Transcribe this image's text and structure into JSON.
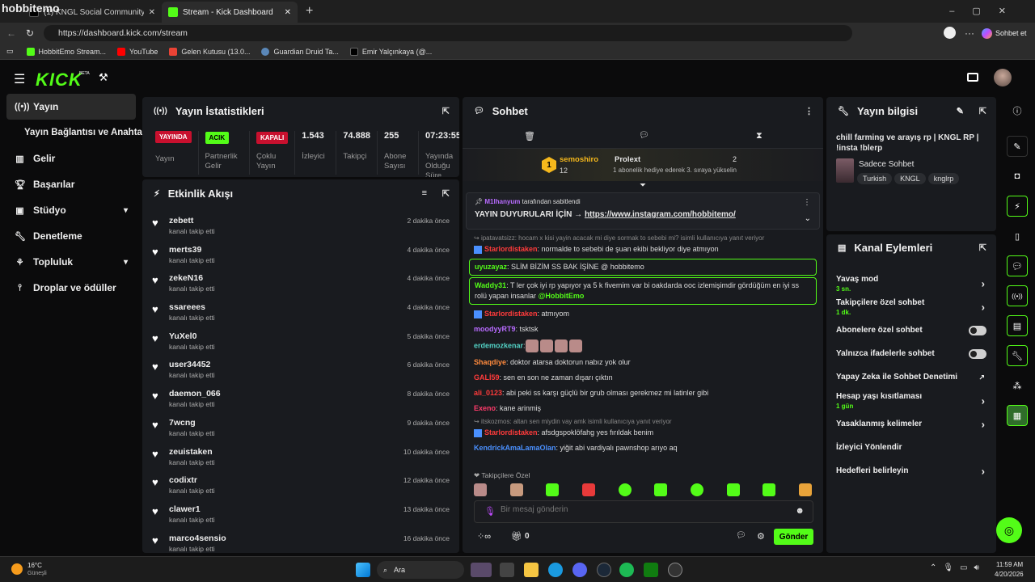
{
  "browser": {
    "watermark": "hobbitemo",
    "tabs": [
      {
        "label": "(1) KNGL Social Community / X"
      },
      {
        "label": "Stream - Kick Dashboard"
      }
    ],
    "url": "https://dashboard.kick.com/stream",
    "profile_btn": "Sohbet et",
    "bookmarks": [
      "HobbitEmo Stream...",
      "YouTube",
      "Gelen Kutusu (13.0...",
      "Guardian Druid Ta...",
      "Emir Yalçınkaya (@..."
    ]
  },
  "header": {
    "logo": "KICK",
    "beta": "BETA"
  },
  "sidebar": {
    "items": [
      {
        "label": "Yayın"
      },
      {
        "label": "Yayın Bağlantısı ve Anahtarı"
      },
      {
        "label": "Gelir"
      },
      {
        "label": "Başarılar"
      },
      {
        "label": "Stüdyo"
      },
      {
        "label": "Denetleme"
      },
      {
        "label": "Topluluk"
      },
      {
        "label": "Droplar ve ödüller"
      }
    ]
  },
  "stats": {
    "title": "Yayın İstatistikleri",
    "items": [
      {
        "badge": "YAYINDA",
        "label": "Yayın"
      },
      {
        "badge": "ACIK",
        "label": "Partnerlik Gelir"
      },
      {
        "badge": "KAPALI",
        "label": "Çoklu Yayın"
      },
      {
        "num": "1.543",
        "label": "İzleyici"
      },
      {
        "num": "74.888",
        "label": "Takipçi"
      },
      {
        "num": "255",
        "label": "Abone Sayısı"
      },
      {
        "num": "07:23:55",
        "label": "Yayında Olduğu Süre"
      }
    ]
  },
  "activity": {
    "title": "Etkinlik Akışı",
    "items": [
      {
        "name": "zebett",
        "sub": "kanalı takip etti",
        "time": "2 dakika önce"
      },
      {
        "name": "merts39",
        "sub": "kanalı takip etti",
        "time": "4 dakika önce"
      },
      {
        "name": "zekeN16",
        "sub": "kanalı takip etti",
        "time": "4 dakika önce"
      },
      {
        "name": "ssareees",
        "sub": "kanalı takip etti",
        "time": "4 dakika önce"
      },
      {
        "name": "YuXel0",
        "sub": "kanalı takip etti",
        "time": "5 dakika önce"
      },
      {
        "name": "user34452",
        "sub": "kanalı takip etti",
        "time": "6 dakika önce"
      },
      {
        "name": "daemon_066",
        "sub": "kanalı takip etti",
        "time": "8 dakika önce"
      },
      {
        "name": "7wcng",
        "sub": "kanalı takip etti",
        "time": "9 dakika önce"
      },
      {
        "name": "zeuistaken",
        "sub": "kanalı takip etti",
        "time": "10 dakika önce"
      },
      {
        "name": "codixtr",
        "sub": "kanalı takip etti",
        "time": "12 dakika önce"
      },
      {
        "name": "clawer1",
        "sub": "kanalı takip etti",
        "time": "13 dakika önce"
      },
      {
        "name": "marco4sensio",
        "sub": "kanalı takip etti",
        "time": "16 dakika önce"
      }
    ]
  },
  "chat": {
    "title": "Sohbet",
    "top_user": "semoshiro",
    "top_count": "12",
    "top_rank": "1",
    "second_user": "Prolext",
    "second_count": "2",
    "gift_note": "1 abonelik hediye ederek 3. sıraya yükselin",
    "pinned_by": "M1lhanyum",
    "pinned_suffix": "tarafından sabitlendi",
    "pinned_text": "YAYIN DUYURULARI İÇİN →",
    "pinned_link": "https://www.instagram.com/hobbitemo/",
    "messages": [
      {
        "reply": "ipatavatsizz: hocam x kisi yayin acacak mi diye sormak to sebebi mi? isimli kullanıcıya yanıt veriyor",
        "user": "Starlordistaken",
        "color": "#ff3b3b",
        "text": ": normalde to sebebi de şuan ekibi bekliyor diye atmıyon"
      },
      {
        "user": "uyuzayaz",
        "color": "#53fc18",
        "text": ": SLİM BİZİM SS BAK İŞİNE @ hobbitemo",
        "boxed": true
      },
      {
        "user": "Waddy31",
        "color": "#53fc18",
        "text": ": T ler çok iyi rp yapıyor ya 5 k fivemim var bi oakdarda ooc izlemişimdir gördüğüm en iyi ss rolü yapan insanlar ",
        "mention": "@HobbitEmo",
        "boxed": true
      },
      {
        "user": "Starlordistaken",
        "color": "#ff3b3b",
        "text": ": atmıyom"
      },
      {
        "user": "moodyyRT9",
        "color": "#b86bff",
        "text": ": tsktsk"
      },
      {
        "user": "erdemozkenar",
        "color": "#53d3c6",
        "text": ":",
        "emotes": 4
      },
      {
        "user": "Shaqdiye",
        "color": "#ff8a3d",
        "text": ": doktor atarsa doktorun nabız yok olur"
      },
      {
        "user": "GALİ59",
        "color": "#ff3b3b",
        "text": ": sen en son ne zaman dışarı çıktın"
      },
      {
        "user": "ali_0123",
        "color": "#ff3b3b",
        "text": ": abi peki ss karşı güçlü bir grub olması gerekmez mi latinler gibi"
      },
      {
        "user": "Exeno",
        "color": "#ff3b6b",
        "text": ": kane arinmiş"
      },
      {
        "reply": "itskozmos: altan sen miydin vay amk isimli kullanıcıya yanıt veriyor",
        "user": "Starlordistaken",
        "color": "#ff3b3b",
        "text": ": afsdgspoklöfahg yes fırıldak benim"
      },
      {
        "user": "KendrickAmaLamaOlan",
        "color": "#4a90ff",
        "text": ": yiğit abi vardiyalı pawnshop arıyo aq"
      }
    ],
    "followers_only": "Takipçilere Özel",
    "placeholder": "Bir mesaj gönderin",
    "send": "Gönder",
    "count0": "0"
  },
  "info": {
    "title": "Yayın bilgisi",
    "stream_title": "chill farming ve arayış rp | KNGL RP | !insta !blerp",
    "category": "Sadece Sohbet",
    "tags": [
      "Turkish",
      "KNGL",
      "knglrp"
    ]
  },
  "actions": {
    "title": "Kanal Eylemleri",
    "rows": [
      {
        "label": "Yavaş mod",
        "sub": "3 sn.",
        "type": "chevron"
      },
      {
        "label": "Takipçilere özel sohbet",
        "sub": "1 dk.",
        "type": "chevron"
      },
      {
        "label": "Abonelere özel sohbet",
        "type": "toggle"
      },
      {
        "label": "Yalnızca ifadelerle sohbet",
        "type": "toggle"
      },
      {
        "label": "Yapay Zeka ile Sohbet Denetimi",
        "type": "ext"
      },
      {
        "label": "Hesap yaşı kısıtlaması",
        "sub": "1 gün",
        "type": "chevron"
      },
      {
        "label": "Yasaklanmış kelimeler",
        "type": "chevron"
      },
      {
        "label": "İzleyici Yönlendir",
        "type": "none"
      },
      {
        "label": "Hedefleri belirleyin",
        "type": "chevron"
      }
    ]
  },
  "taskbar": {
    "temp": "16°C",
    "weather": "Güneşli",
    "search": "Ara",
    "time": "11:59 AM",
    "date": "4/20/2026"
  }
}
